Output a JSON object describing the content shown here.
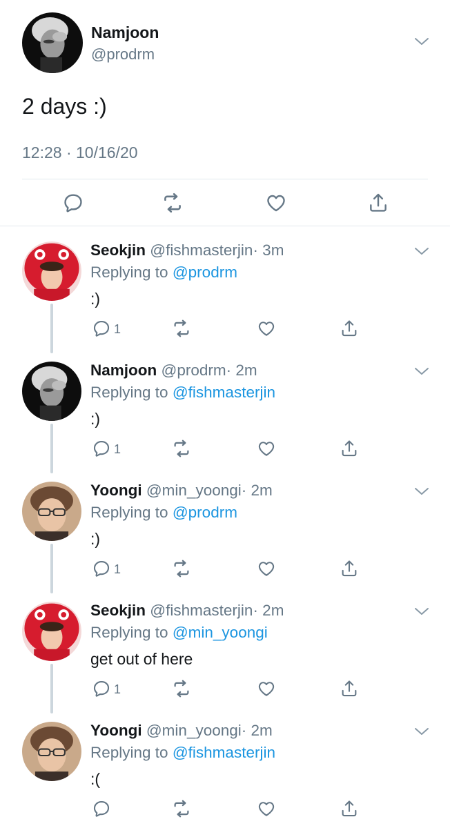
{
  "main_tweet": {
    "name": "Namjoon",
    "handle": "@prodrm",
    "text": "2 days :)",
    "timestamp": "12:28 · 10/16/20",
    "avatar_style": "grayscale"
  },
  "colors": {
    "text": "#14171a",
    "secondary": "#657786",
    "link": "#1b95e0",
    "divider": "#e1e8ed",
    "thread_line": "#ccd6dd"
  },
  "icons": [
    "reply-icon",
    "retweet-icon",
    "like-icon",
    "share-icon",
    "chevron-down-icon"
  ],
  "replies": [
    {
      "name": "Seokjin",
      "handle": "@fishmasterjin",
      "time": "· 3m",
      "replying_prefix": "Replying to ",
      "replying_to": "@prodrm",
      "text": ":)",
      "reply_count": "1",
      "avatar_style": "red"
    },
    {
      "name": "Namjoon",
      "handle": "@prodrm",
      "time": "· 2m",
      "replying_prefix": "Replying to ",
      "replying_to": "@fishmasterjin",
      "text": ":)",
      "reply_count": "1",
      "avatar_style": "grayscale"
    },
    {
      "name": "Yoongi",
      "handle": "@min_yoongi",
      "time": "· 2m",
      "replying_prefix": "Replying to ",
      "replying_to": "@prodrm",
      "text": ":)",
      "reply_count": "1",
      "avatar_style": "warm"
    },
    {
      "name": "Seokjin",
      "handle": "@fishmasterjin",
      "time": "· 2m",
      "replying_prefix": "Replying to ",
      "replying_to": "@min_yoongi",
      "text": "get out of here",
      "reply_count": "1",
      "avatar_style": "red"
    },
    {
      "name": "Yoongi",
      "handle": "@min_yoongi",
      "time": "· 2m",
      "replying_prefix": "Replying to ",
      "replying_to": "@fishmasterjin",
      "text": ":(",
      "reply_count": "",
      "avatar_style": "warm"
    }
  ]
}
